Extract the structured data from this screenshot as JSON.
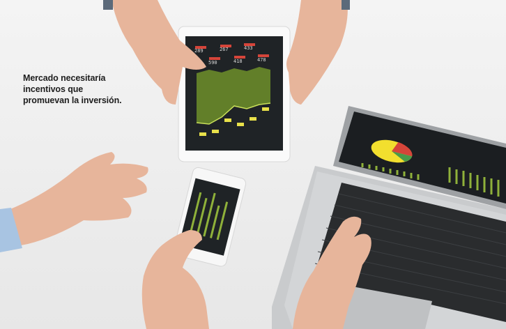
{
  "caption": {
    "lines": [
      "Mercado necesitaría",
      "incentivos que",
      "promuevan la inversión."
    ]
  },
  "tablet": {
    "labels": [
      "289",
      "267",
      "433",
      "590",
      "418",
      "478"
    ]
  },
  "colors": {
    "background": "#efefef",
    "screen": "#1f2326",
    "chart_green": "#9fbf3a",
    "label_red": "#d6453a",
    "label_yellow": "#e8e04a",
    "pie_yellow": "#f2df2e",
    "pie_red": "#d6453a"
  }
}
